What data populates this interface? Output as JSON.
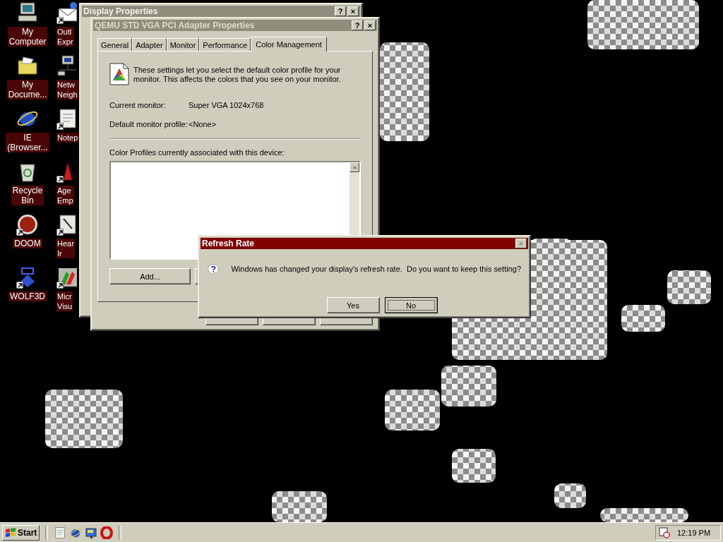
{
  "desktop_icons": [
    {
      "kind": "computer",
      "lines": [
        "My",
        "Computer"
      ],
      "shortcut": false
    },
    {
      "kind": "folder",
      "lines": [
        "My",
        "Docume..."
      ],
      "shortcut": false
    },
    {
      "kind": "browser",
      "lines": [
        "IE",
        "(Browser..."
      ],
      "shortcut": false
    },
    {
      "kind": "bin",
      "lines": [
        "Recycle",
        "Bin"
      ],
      "shortcut": false
    },
    {
      "kind": "doom",
      "lines": [
        "DOOM"
      ],
      "shortcut": true
    },
    {
      "kind": "wolf",
      "lines": [
        "WOLF3D"
      ],
      "shortcut": true
    },
    {
      "kind": "mail",
      "lines": [
        "Outl",
        "Expr"
      ],
      "shortcut": true
    },
    {
      "kind": "network",
      "lines": [
        "Netw",
        "Neigh"
      ],
      "shortcut": false
    },
    {
      "kind": "notepad",
      "lines": [
        "Notep"
      ],
      "shortcut": true
    },
    {
      "kind": "game",
      "lines": [
        "Age",
        "Emp"
      ],
      "shortcut": true
    },
    {
      "kind": "document",
      "lines": [
        "Hear",
        "Ir"
      ],
      "shortcut": true
    },
    {
      "kind": "palette",
      "lines": [
        "Micr",
        "Visu"
      ],
      "shortcut": true
    }
  ],
  "background_window": {
    "title": "Display Properties",
    "title_buttons": [
      "?",
      "×"
    ]
  },
  "adapter_window": {
    "title": "QEMU STD VGA PCI Adapter Properties",
    "title_buttons": [
      "?",
      "×"
    ],
    "tabs": [
      {
        "label": "General",
        "selected": false
      },
      {
        "label": "Adapter",
        "selected": false
      },
      {
        "label": "Monitor",
        "selected": false
      },
      {
        "label": "Performance",
        "selected": false
      },
      {
        "label": "Color Management",
        "selected": true
      }
    ],
    "description": "These settings let you select the default color profile for your monitor. This affects the colors that you see on your monitor.",
    "fields": [
      {
        "label": "Current monitor:",
        "value": "Super VGA 1024x768"
      },
      {
        "label": "Default monitor profile:",
        "value": "<None>"
      }
    ],
    "profiles_label": "Color Profiles currently associated with this device:",
    "buttons": [
      "Add..."
    ]
  },
  "refresh_dialog": {
    "title": "Refresh Rate",
    "close_button": {
      "label": "×",
      "disabled": true
    },
    "message": "Windows has changed your display's refresh rate.  Do you want to keep this setting?",
    "buttons": [
      {
        "label": "Yes",
        "focused": false
      },
      {
        "label": "No",
        "focused": true
      }
    ]
  },
  "taskbar": {
    "start": "Start",
    "quick_launch": [
      {
        "kind": "notepad"
      },
      {
        "kind": "browser"
      },
      {
        "kind": "desktop"
      },
      {
        "kind": "opera"
      }
    ],
    "tray_time": "12:19 PM"
  }
}
